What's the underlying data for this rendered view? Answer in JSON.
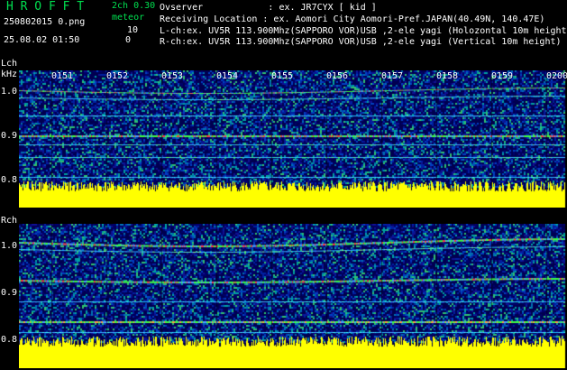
{
  "header": {
    "logo": "H R O F F T",
    "version": "2ch 0.30",
    "meteor_label": "meteor",
    "count_l": "10",
    "count_r": "0",
    "filename": "250802015 0.png",
    "datetime": "25.08.02 01:50",
    "observer": "Ovserver            : ex. JR7CYX [ kid ]",
    "location": "Receiving Location : ex. Aomori City Aomori-Pref.JAPAN(40.49N, 140.47E)",
    "lch_info": "L-ch:ex. UV5R 113.900Mhz(SAPPORO VOR)USB ,2-ele yagi (Holozontal 10m height)",
    "rch_info": "R-ch:ex. UV5R 113.900Mhz(SAPPORO VOR)USB ,2-ele yagi (Vertical 10m height)"
  },
  "lch": {
    "label": "Lch",
    "unit": "kHz",
    "ticks": [
      "1.0",
      "0.9",
      "0.8"
    ]
  },
  "rch": {
    "label": "Rch",
    "ticks": [
      "1.0",
      "0.9",
      "0.8"
    ]
  },
  "time_labels": [
    "0151",
    "0152",
    "0153",
    "0154",
    "0155",
    "0156",
    "0157",
    "0158",
    "0159",
    "0200"
  ],
  "colors": {
    "background": "#000000",
    "logo": "#00e050",
    "signal": "#ffff00"
  }
}
